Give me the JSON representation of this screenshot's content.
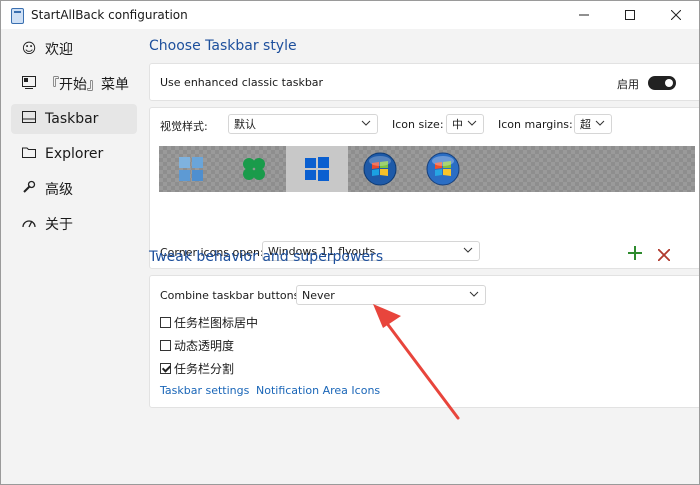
{
  "window": {
    "title": "StartAllBack configuration"
  },
  "sidebar": {
    "items": [
      {
        "label": "欢迎",
        "icon": "smile-icon"
      },
      {
        "label": "『开始』菜单",
        "icon": "start-menu-icon"
      },
      {
        "label": "Taskbar",
        "icon": "taskbar-icon"
      },
      {
        "label": "Explorer",
        "icon": "folder-icon"
      },
      {
        "label": "高级",
        "icon": "wrench-icon"
      },
      {
        "label": "关于",
        "icon": "speed-icon"
      }
    ]
  },
  "taskbar_style": {
    "section_title": "Choose Taskbar style",
    "enhanced_label": "Use enhanced classic taskbar",
    "toggle_label": "启用",
    "visual_style_label": "视觉样式:",
    "visual_style_value": "默认",
    "icon_size_label": "Icon size:",
    "icon_size_value": "中",
    "icon_margins_label": "Icon margins:",
    "icon_margins_value": "超",
    "corner_icons_label": "Corner icons open:",
    "corner_icons_value": "Windows 11 flyouts",
    "styles": [
      "win11-flat-icon",
      "clover-icon",
      "win10-icon",
      "win7-orb-icon",
      "vista-orb-icon"
    ]
  },
  "tweak": {
    "section_title": "Tweak behavior and superpowers",
    "combine_label": "Combine taskbar buttons:",
    "combine_value": "Never",
    "options": [
      {
        "label": "任务栏图标居中",
        "checked": false
      },
      {
        "label": "动态透明度",
        "checked": false
      },
      {
        "label": "任务栏分割",
        "checked": true
      }
    ],
    "link_taskbar_settings": "Taskbar settings",
    "link_notification": "Notification Area Icons"
  },
  "colors": {
    "accent": "#1d4f9c",
    "link": "#1a66b8",
    "add": "#2e8b2e",
    "remove": "#b03a2e",
    "arrow": "#e8453c"
  }
}
